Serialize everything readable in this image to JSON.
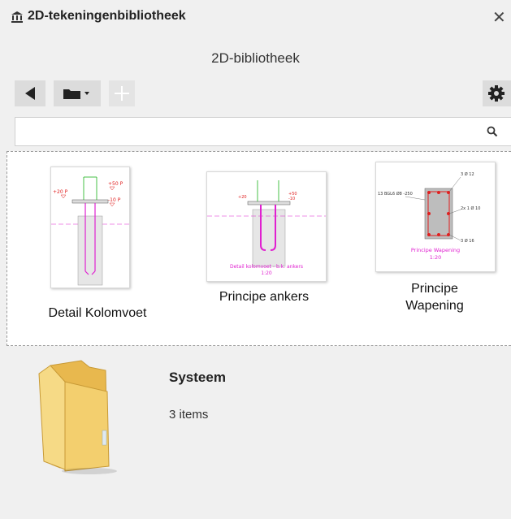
{
  "window": {
    "title": "2D-tekeningenbibliotheek",
    "close_label": "✕"
  },
  "subtitle": "2D-bibliotheek",
  "toolbar": {
    "back_icon": "back-arrow-icon",
    "folder_icon": "folder-dropdown-icon",
    "add_icon": "plus-icon",
    "settings_icon": "gear-icon"
  },
  "search": {
    "value": "",
    "placeholder": ""
  },
  "items": [
    {
      "label": "Detail Kolomvoet",
      "thumb_texts": [
        "+20 P",
        "+50 P",
        "-10 P"
      ]
    },
    {
      "label": "Principe ankers",
      "thumb_texts": [
        "+20",
        "+50",
        "-10",
        "Detail kolomvoet - b.k. ankers",
        "1:20"
      ]
    },
    {
      "label_line1": "Principe",
      "label_line2": "Wapening",
      "thumb_texts": [
        "13 BGL6 Ø8 -250",
        "3 Ø 12",
        "2x 1 Ø 10",
        "3 Ø 16",
        "Principe Wapening",
        "1:20"
      ]
    }
  ],
  "folder": {
    "name": "Systeem",
    "count": "3 items"
  },
  "colors": {
    "magenta": "#e020d0",
    "green": "#19b319",
    "red": "#e02020",
    "folder_yellow": "#f3cf6e"
  }
}
